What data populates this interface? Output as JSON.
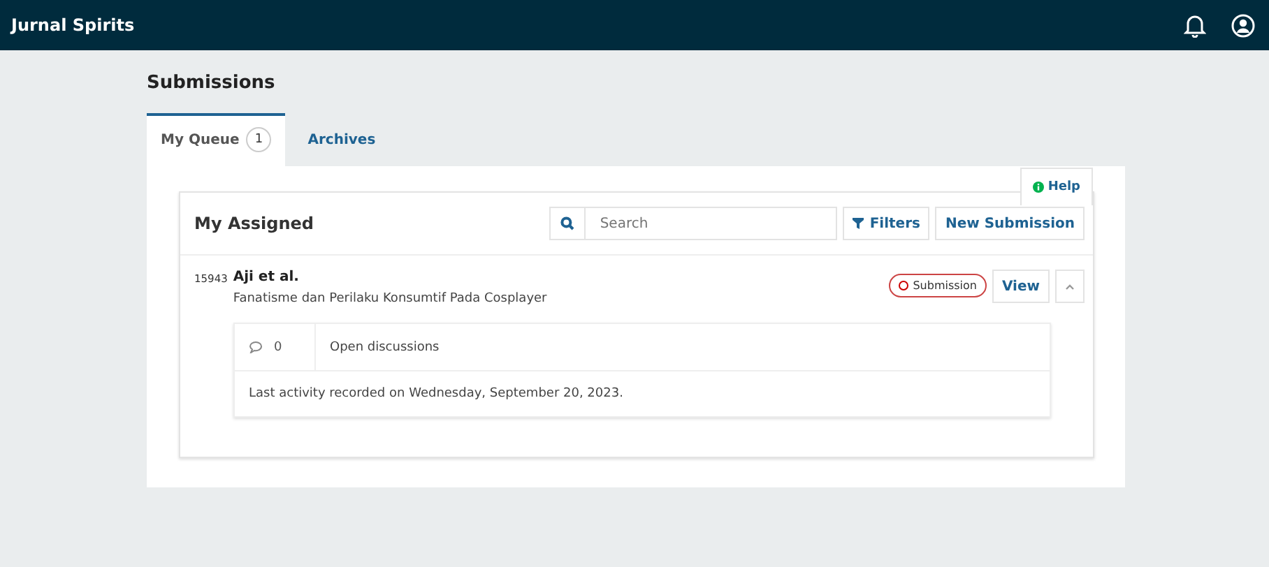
{
  "app_bar": {
    "title": "Jurnal Spirits"
  },
  "page": {
    "title": "Submissions"
  },
  "tabs": [
    {
      "label": "My Queue",
      "count": "1",
      "selected": true
    },
    {
      "label": "Archives",
      "selected": false
    }
  ],
  "help": {
    "label": "Help"
  },
  "list": {
    "title": "My Assigned",
    "search": {
      "placeholder": "Search"
    },
    "filters_label": "Filters",
    "new_label": "New Submission",
    "items": [
      {
        "id": "15943",
        "authors": "Aji et al.",
        "title": "Fanatisme dan Perilaku Konsumtif Pada Cosplayer",
        "stage": "Submission",
        "view_label": "View",
        "expanded": true,
        "discussion_count": "0",
        "discussions_label": "Open discussions",
        "activity": "Last activity recorded on Wednesday, September 20, 2023."
      }
    ]
  }
}
